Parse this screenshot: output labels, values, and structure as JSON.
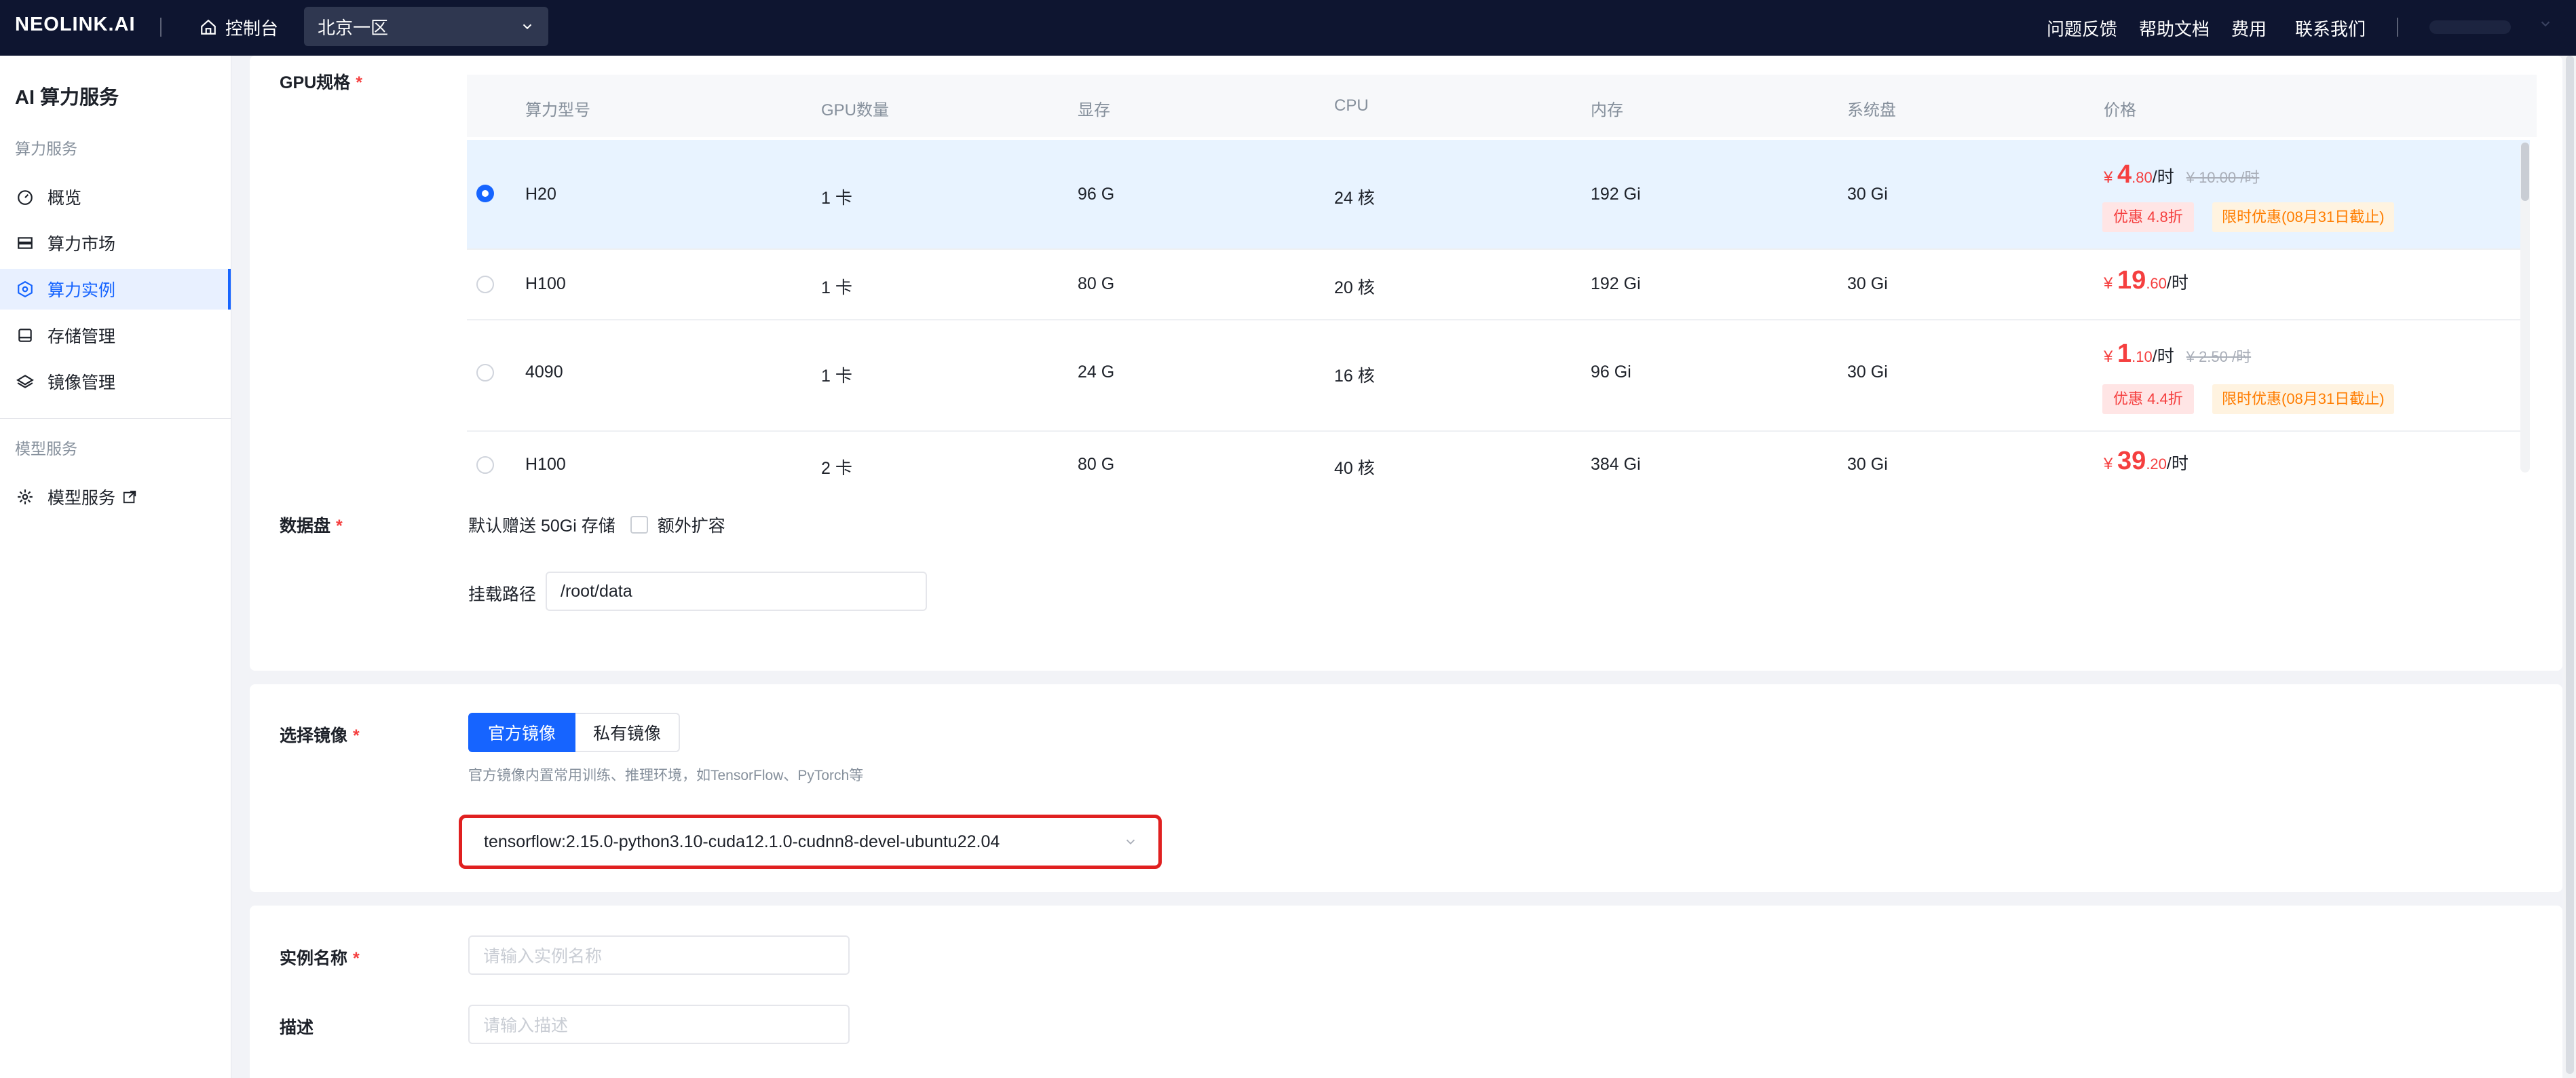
{
  "topbar": {
    "logo": "NEOLINK.AI",
    "console": "控制台",
    "region": "北京一区",
    "nav": [
      "问题反馈",
      "帮助文档",
      "费用",
      "联系我们"
    ]
  },
  "sidebar": {
    "title": "AI 算力服务",
    "group_compute": "算力服务",
    "items": [
      "概览",
      "算力市场",
      "算力实例",
      "存储管理",
      "镜像管理"
    ],
    "group_model": "模型服务",
    "model_service": "模型服务"
  },
  "gpu": {
    "label": "GPU规格",
    "columns": [
      "算力型号",
      "GPU数量",
      "显存",
      "CPU",
      "内存",
      "系统盘",
      "价格"
    ],
    "rows": [
      {
        "model": "H20",
        "gpus": "1 卡",
        "vram": "96 G",
        "cpu": "24 核",
        "mem": "192 Gi",
        "disk": "30 Gi",
        "currency": "¥",
        "price_int": "4",
        "price_dec": ".80",
        "unit": "/时",
        "orig": "¥ 10.00 /时",
        "discount": "优惠 4.8折",
        "promo": "限时优惠(08月31日截止)",
        "selected": true
      },
      {
        "model": "H100",
        "gpus": "1 卡",
        "vram": "80 G",
        "cpu": "20 核",
        "mem": "192 Gi",
        "disk": "30 Gi",
        "currency": "¥",
        "price_int": "19",
        "price_dec": ".60",
        "unit": "/时",
        "selected": false
      },
      {
        "model": "4090",
        "gpus": "1 卡",
        "vram": "24 G",
        "cpu": "16 核",
        "mem": "96 Gi",
        "disk": "30 Gi",
        "currency": "¥",
        "price_int": "1",
        "price_dec": ".10",
        "unit": "/时",
        "orig": "¥ 2.50 /时",
        "discount": "优惠 4.4折",
        "promo": "限时优惠(08月31日截止)",
        "selected": false
      },
      {
        "model": "H100",
        "gpus": "2 卡",
        "vram": "80 G",
        "cpu": "40 核",
        "mem": "384 Gi",
        "disk": "30 Gi",
        "currency": "¥",
        "price_int": "39",
        "price_dec": ".20",
        "unit": "/时",
        "selected": false
      }
    ]
  },
  "data_disk": {
    "label": "数据盘",
    "default_text": "默认赠送 50Gi 存储",
    "expand_label": "额外扩容",
    "mount_label": "挂载路径",
    "mount_value": "/root/data"
  },
  "image": {
    "label": "选择镜像",
    "tab_official": "官方镜像",
    "tab_private": "私有镜像",
    "hint": "官方镜像内置常用训练、推理环境，如TensorFlow、PyTorch等",
    "selected": "tensorflow:2.15.0-python3.10-cuda12.1.0-cudnn8-devel-ubuntu22.04"
  },
  "instance": {
    "name_label": "实例名称",
    "name_placeholder": "请输入实例名称",
    "desc_label": "描述",
    "desc_placeholder": "请输入描述"
  },
  "colors": {
    "primary": "#1664ff",
    "topbar": "#0e1530",
    "price_red": "#f53f3f",
    "promo_orange": "#ff7d00",
    "highlight_border": "#e02020"
  }
}
